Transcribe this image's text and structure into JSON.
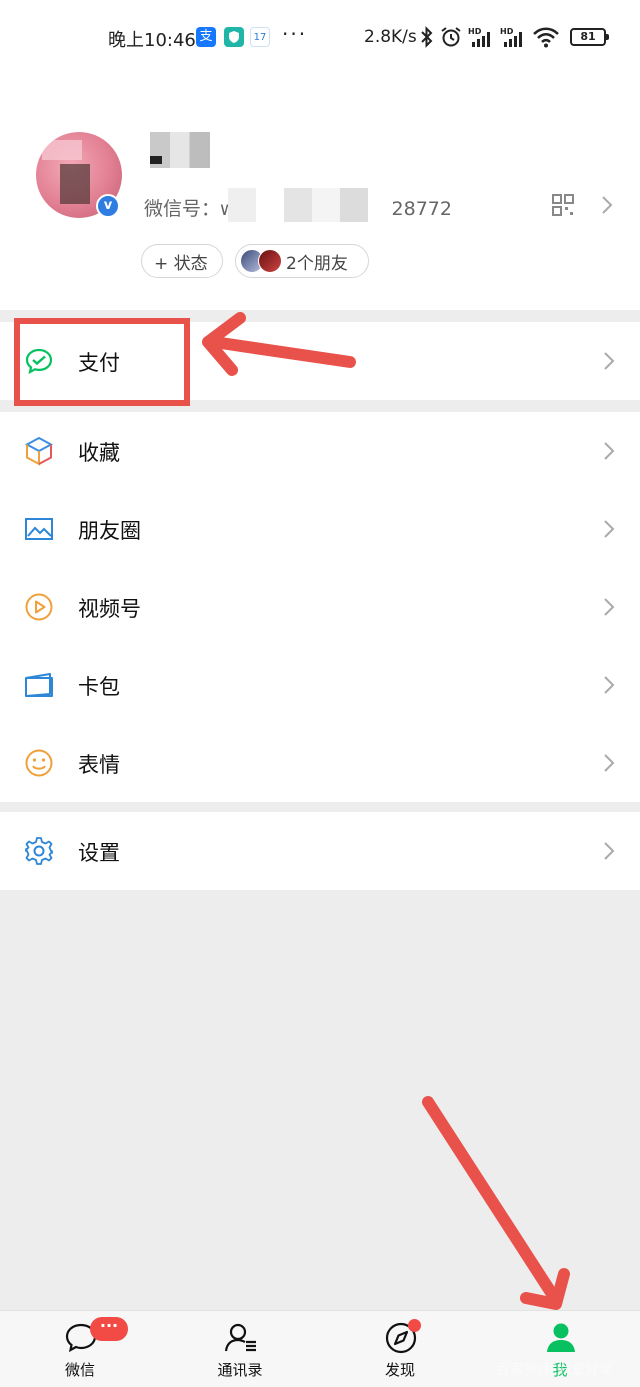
{
  "status_bar": {
    "time": "晚上10:46",
    "alipay_badge": "支",
    "calendar_badge": "17",
    "more_dots": "···",
    "net_speed": "2.8K/s",
    "hd1": "HD",
    "hd2": "HD",
    "wifi_num": "6",
    "battery": "81"
  },
  "profile": {
    "wechat_id_label": "微信号：w",
    "wechat_id_tail": "28772",
    "status_pill": "+ 状态",
    "friends_pill": "2个朋友",
    "verify_mark": "v"
  },
  "menu_groups": [
    {
      "items": [
        {
          "label": "支付",
          "icon": "pay-icon"
        }
      ]
    },
    {
      "items": [
        {
          "label": "收藏",
          "icon": "favorites-icon"
        },
        {
          "label": "朋友圈",
          "icon": "moments-icon"
        },
        {
          "label": "视频号",
          "icon": "channels-icon"
        },
        {
          "label": "卡包",
          "icon": "card-wallet-icon"
        },
        {
          "label": "表情",
          "icon": "sticker-icon"
        }
      ]
    },
    {
      "items": [
        {
          "label": "设置",
          "icon": "settings-icon"
        }
      ]
    }
  ],
  "tabbar": {
    "tabs": [
      {
        "label": "微信",
        "icon": "chat-icon",
        "badge": "···"
      },
      {
        "label": "通讯录",
        "icon": "contacts-icon"
      },
      {
        "label": "发现",
        "icon": "discover-icon"
      },
      {
        "label": "我",
        "icon": "me-icon",
        "active": true
      }
    ]
  },
  "watermark": "百家号/我们爱分享",
  "colors": {
    "wechat_green": "#07c160",
    "annotation_red": "#e9524a",
    "badge_red": "#f24a44",
    "page_bg": "#ededed"
  }
}
